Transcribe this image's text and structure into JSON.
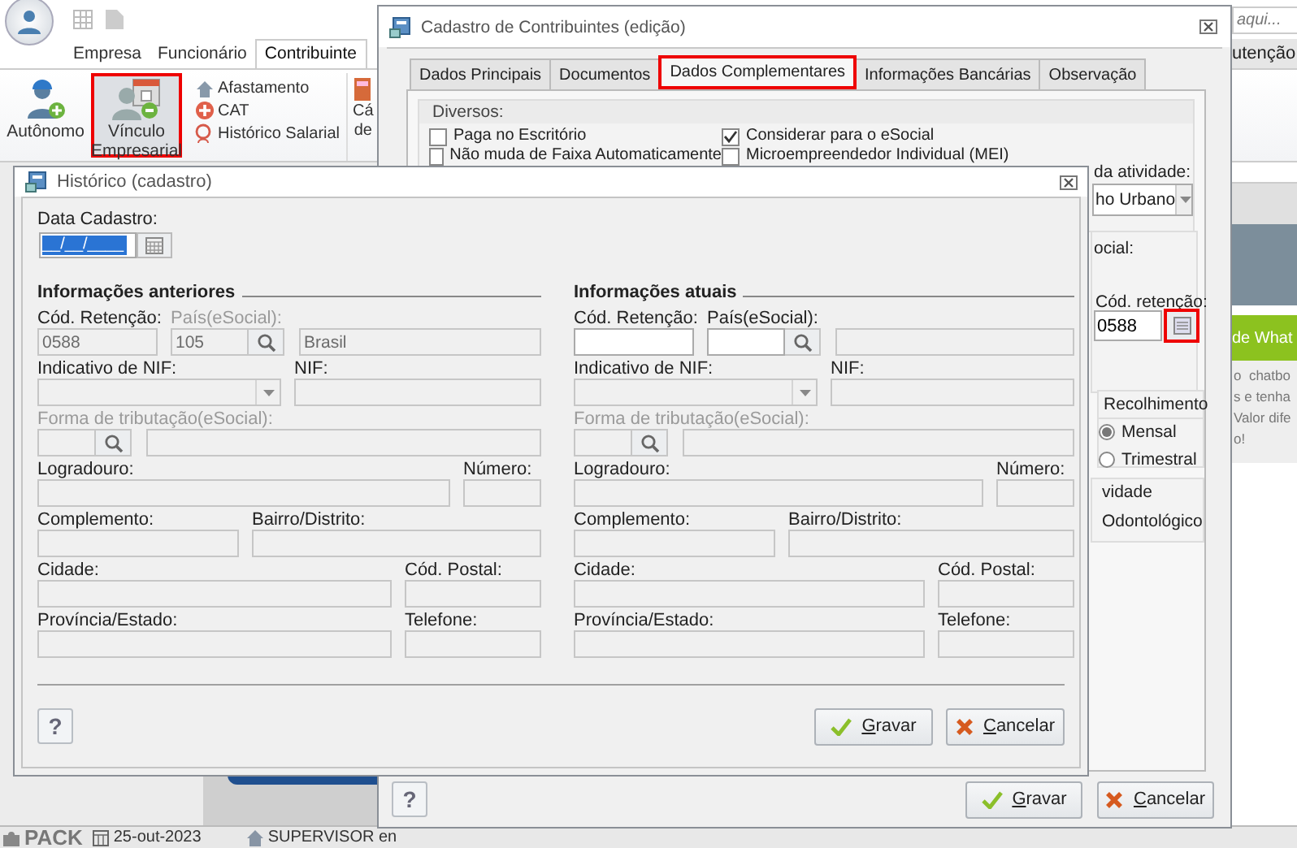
{
  "app": {
    "search_placeholder": "aqui...",
    "ribbon_tabs": [
      {
        "label": "Empresa",
        "selected": false
      },
      {
        "label": "Funcionário",
        "selected": false
      },
      {
        "label": "Contribuinte",
        "selected": true
      }
    ],
    "right_tab": "utenção",
    "large_buttons": [
      {
        "kind": "autonomo",
        "label": "Autônomo",
        "highlighted": false
      },
      {
        "kind": "vinculo",
        "label": "Vínculo Empresarial",
        "highlighted": true
      }
    ],
    "small_buttons": [
      {
        "kind": "afastamento",
        "label": "Afastamento"
      },
      {
        "kind": "cat",
        "label": "CAT"
      },
      {
        "kind": "historico",
        "label": "Histórico Salarial"
      }
    ],
    "cut_button": "Cá\nde"
  },
  "background_page": {
    "banner": "de What",
    "text_lines": [
      "o  chatbo",
      "s e tenha",
      "Valor dife",
      "o!"
    ]
  },
  "main_dialog": {
    "title": "Cadastro de Contribuintes (edição)",
    "tabs": [
      {
        "label": "Dados Principais",
        "selected": false,
        "highlighted": false
      },
      {
        "label": "Documentos",
        "selected": false,
        "highlighted": false
      },
      {
        "label": "Dados Complementares",
        "selected": true,
        "highlighted": true
      },
      {
        "label": "Informações Bancárias",
        "selected": false,
        "highlighted": false
      },
      {
        "label": "Observação",
        "selected": false,
        "highlighted": false
      }
    ],
    "diversos": {
      "title": "Diversos:",
      "checkboxes": [
        {
          "label": "Paga no Escritório",
          "checked": false
        },
        {
          "label": "Considerar para o eSocial",
          "checked": true
        },
        {
          "label": "Não muda de Faixa Automaticamente",
          "checked": false
        },
        {
          "label": "Microempreendedor Individual (MEI)",
          "checked": false
        }
      ]
    },
    "activity_label": "da atividade:",
    "activity_value": "ho Urbano",
    "esocial_group": {
      "title": "ocial:",
      "label": "Cód. retenção:",
      "value": "0588",
      "button_highlighted": true
    },
    "recolhimento": {
      "title": "Recolhimento",
      "options": [
        {
          "label": "Mensal",
          "selected": true
        },
        {
          "label": "Trimestral",
          "selected": false
        }
      ]
    },
    "atividade_group": {
      "title": "vidade",
      "value": "Odontológico"
    },
    "help": "?",
    "buttons": [
      {
        "kind": "save",
        "label": "Gravar"
      },
      {
        "kind": "cancel",
        "label": "Cancelar"
      }
    ]
  },
  "history_dialog": {
    "title": "Histórico (cadastro)",
    "date_label": "Data Cadastro:",
    "date_value": "__/__/____",
    "sections": [
      {
        "title": "Informações anteriores",
        "rows": [
          [
            {
              "kind": "text",
              "label": "Cód. Retenção:",
              "value": "0588",
              "disabled": true,
              "label_disabled": false
            },
            {
              "kind": "lookup",
              "label": "País(eSocial):",
              "value": "105",
              "description": "Brasil",
              "disabled": true,
              "label_disabled": true
            }
          ],
          [
            {
              "kind": "combo",
              "label": "Indicativo de NIF:",
              "disabled": true,
              "label_disabled": false
            },
            {
              "kind": "text",
              "label": "NIF:",
              "disabled": true,
              "label_disabled": false
            }
          ],
          [
            {
              "kind": "lookup",
              "label": "Forma de tributação(eSocial):",
              "disabled": true,
              "label_disabled": true
            }
          ],
          [
            {
              "kind": "text",
              "label": "Logradouro:",
              "disabled": true,
              "label_disabled": false
            },
            {
              "kind": "text",
              "label": "Número:",
              "disabled": true,
              "label_disabled": false
            }
          ],
          [
            {
              "kind": "text",
              "label": "Complemento:",
              "disabled": true,
              "label_disabled": false
            },
            {
              "kind": "text",
              "label": "Bairro/Distrito:",
              "disabled": true,
              "label_disabled": false
            }
          ],
          [
            {
              "kind": "text",
              "label": "Cidade:",
              "disabled": true,
              "label_disabled": false
            },
            {
              "kind": "text",
              "label": "Cód. Postal:",
              "disabled": true,
              "label_disabled": false
            }
          ],
          [
            {
              "kind": "text",
              "label": "Província/Estado:",
              "disabled": true,
              "label_disabled": false
            },
            {
              "kind": "text",
              "label": "Telefone:",
              "disabled": true,
              "label_disabled": false
            }
          ]
        ]
      },
      {
        "title": "Informações atuais",
        "rows": [
          [
            {
              "kind": "text",
              "label": "Cód. Retenção:",
              "disabled": false,
              "label_disabled": false
            },
            {
              "kind": "lookup",
              "label": "País(eSocial):",
              "disabled": false,
              "label_disabled": false
            }
          ],
          [
            {
              "kind": "combo",
              "label": "Indicativo de NIF:",
              "disabled": true,
              "label_disabled": false
            },
            {
              "kind": "text",
              "label": "NIF:",
              "disabled": true,
              "label_disabled": false
            }
          ],
          [
            {
              "kind": "lookup",
              "label": "Forma de tributação(eSocial):",
              "disabled": true,
              "label_disabled": true
            }
          ],
          [
            {
              "kind": "text",
              "label": "Logradouro:",
              "disabled": true,
              "label_disabled": false
            },
            {
              "kind": "text",
              "label": "Número:",
              "disabled": true,
              "label_disabled": false
            }
          ],
          [
            {
              "kind": "text",
              "label": "Complemento:",
              "disabled": true,
              "label_disabled": false
            },
            {
              "kind": "text",
              "label": "Bairro/Distrito:",
              "disabled": true,
              "label_disabled": false
            }
          ],
          [
            {
              "kind": "text",
              "label": "Cidade:",
              "disabled": true,
              "label_disabled": false
            },
            {
              "kind": "text",
              "label": "Cód. Postal:",
              "disabled": true,
              "label_disabled": false
            }
          ],
          [
            {
              "kind": "text",
              "label": "Província/Estado:",
              "disabled": true,
              "label_disabled": false
            },
            {
              "kind": "text",
              "label": "Telefone:",
              "disabled": true,
              "label_disabled": false
            }
          ]
        ]
      }
    ],
    "help": "?",
    "buttons": [
      {
        "kind": "save",
        "label": "Gravar"
      },
      {
        "kind": "cancel",
        "label": "Cancelar"
      }
    ]
  },
  "status_bar": {
    "logo": "PACK",
    "date": "25-out-2023",
    "user": "SUPERVISOR en"
  }
}
